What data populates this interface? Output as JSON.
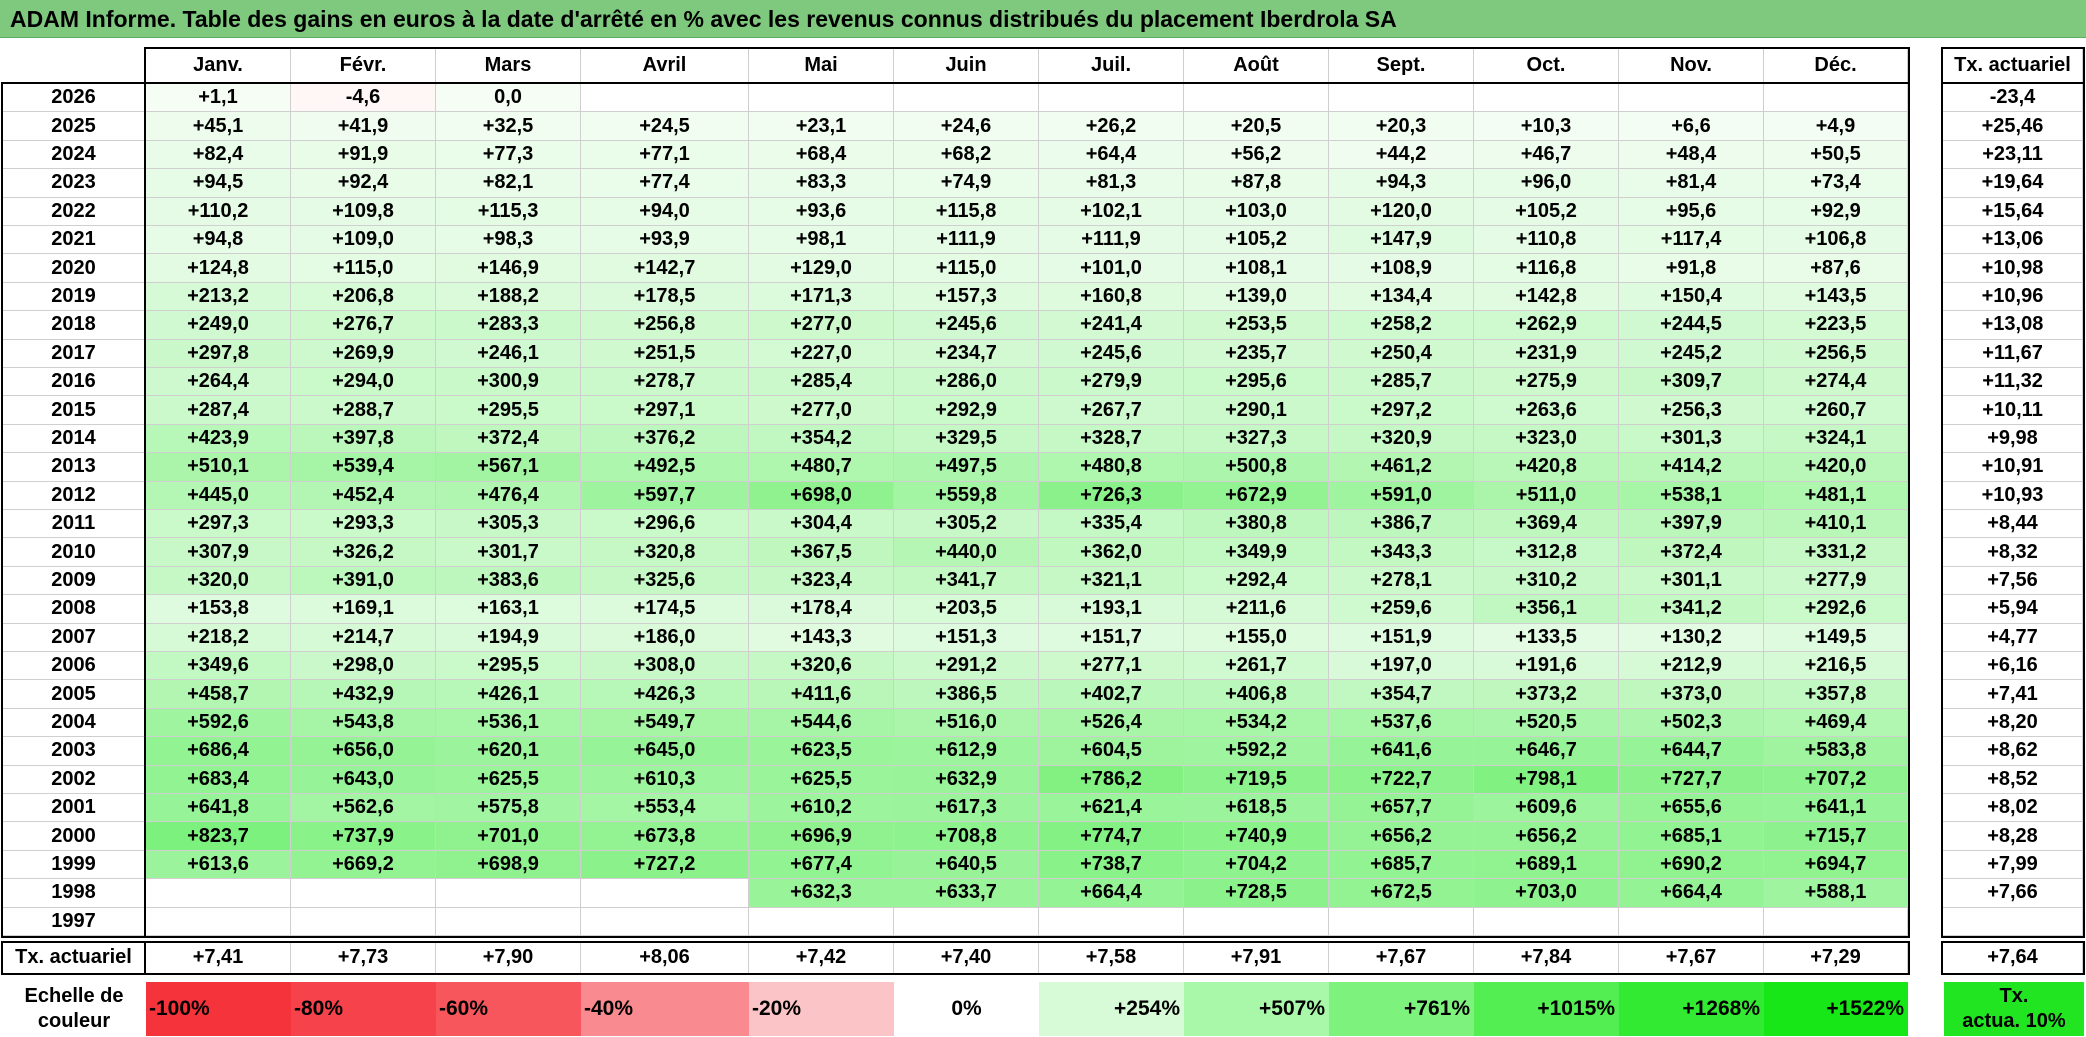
{
  "title": "ADAM Informe. Table des gains en euros à la date d'arrêté en % avec les revenus connus distribués du placement Iberdrola SA",
  "chart_data": {
    "type": "heatmap",
    "months": [
      "Janv.",
      "Févr.",
      "Mars",
      "Avril",
      "Mai",
      "Juin",
      "Juil.",
      "Août",
      "Sept.",
      "Oct.",
      "Nov.",
      "Déc."
    ],
    "rate_header": "Tx. actuariel",
    "rows": [
      {
        "year": "2026",
        "cells": [
          "+1,1",
          "-4,6",
          "0,0",
          "",
          "",
          "",
          "",
          "",
          "",
          "",
          "",
          ""
        ],
        "rate": "-23,4"
      },
      {
        "year": "2025",
        "cells": [
          "+45,1",
          "+41,9",
          "+32,5",
          "+24,5",
          "+23,1",
          "+24,6",
          "+26,2",
          "+20,5",
          "+20,3",
          "+10,3",
          "+6,6",
          "+4,9"
        ],
        "rate": "+25,46"
      },
      {
        "year": "2024",
        "cells": [
          "+82,4",
          "+91,9",
          "+77,3",
          "+77,1",
          "+68,4",
          "+68,2",
          "+64,4",
          "+56,2",
          "+44,2",
          "+46,7",
          "+48,4",
          "+50,5"
        ],
        "rate": "+23,11"
      },
      {
        "year": "2023",
        "cells": [
          "+94,5",
          "+92,4",
          "+82,1",
          "+77,4",
          "+83,3",
          "+74,9",
          "+81,3",
          "+87,8",
          "+94,3",
          "+96,0",
          "+81,4",
          "+73,4"
        ],
        "rate": "+19,64"
      },
      {
        "year": "2022",
        "cells": [
          "+110,2",
          "+109,8",
          "+115,3",
          "+94,0",
          "+93,6",
          "+115,8",
          "+102,1",
          "+103,0",
          "+120,0",
          "+105,2",
          "+95,6",
          "+92,9"
        ],
        "rate": "+15,64"
      },
      {
        "year": "2021",
        "cells": [
          "+94,8",
          "+109,0",
          "+98,3",
          "+93,9",
          "+98,1",
          "+111,9",
          "+111,9",
          "+105,2",
          "+147,9",
          "+110,8",
          "+117,4",
          "+106,8"
        ],
        "rate": "+13,06"
      },
      {
        "year": "2020",
        "cells": [
          "+124,8",
          "+115,0",
          "+146,9",
          "+142,7",
          "+129,0",
          "+115,0",
          "+101,0",
          "+108,1",
          "+108,9",
          "+116,8",
          "+91,8",
          "+87,6"
        ],
        "rate": "+10,98"
      },
      {
        "year": "2019",
        "cells": [
          "+213,2",
          "+206,8",
          "+188,2",
          "+178,5",
          "+171,3",
          "+157,3",
          "+160,8",
          "+139,0",
          "+134,4",
          "+142,8",
          "+150,4",
          "+143,5"
        ],
        "rate": "+10,96"
      },
      {
        "year": "2018",
        "cells": [
          "+249,0",
          "+276,7",
          "+283,3",
          "+256,8",
          "+277,0",
          "+245,6",
          "+241,4",
          "+253,5",
          "+258,2",
          "+262,9",
          "+244,5",
          "+223,5"
        ],
        "rate": "+13,08"
      },
      {
        "year": "2017",
        "cells": [
          "+297,8",
          "+269,9",
          "+246,1",
          "+251,5",
          "+227,0",
          "+234,7",
          "+245,6",
          "+235,7",
          "+250,4",
          "+231,9",
          "+245,2",
          "+256,5"
        ],
        "rate": "+11,67"
      },
      {
        "year": "2016",
        "cells": [
          "+264,4",
          "+294,0",
          "+300,9",
          "+278,7",
          "+285,4",
          "+286,0",
          "+279,9",
          "+295,6",
          "+285,7",
          "+275,9",
          "+309,7",
          "+274,4"
        ],
        "rate": "+11,32"
      },
      {
        "year": "2015",
        "cells": [
          "+287,4",
          "+288,7",
          "+295,5",
          "+297,1",
          "+277,0",
          "+292,9",
          "+267,7",
          "+290,1",
          "+297,2",
          "+263,6",
          "+256,3",
          "+260,7"
        ],
        "rate": "+10,11"
      },
      {
        "year": "2014",
        "cells": [
          "+423,9",
          "+397,8",
          "+372,4",
          "+376,2",
          "+354,2",
          "+329,5",
          "+328,7",
          "+327,3",
          "+320,9",
          "+323,0",
          "+301,3",
          "+324,1"
        ],
        "rate": "+9,98"
      },
      {
        "year": "2013",
        "cells": [
          "+510,1",
          "+539,4",
          "+567,1",
          "+492,5",
          "+480,7",
          "+497,5",
          "+480,8",
          "+500,8",
          "+461,2",
          "+420,8",
          "+414,2",
          "+420,0"
        ],
        "rate": "+10,91"
      },
      {
        "year": "2012",
        "cells": [
          "+445,0",
          "+452,4",
          "+476,4",
          "+597,7",
          "+698,0",
          "+559,8",
          "+726,3",
          "+672,9",
          "+591,0",
          "+511,0",
          "+538,1",
          "+481,1"
        ],
        "rate": "+10,93"
      },
      {
        "year": "2011",
        "cells": [
          "+297,3",
          "+293,3",
          "+305,3",
          "+296,6",
          "+304,4",
          "+305,2",
          "+335,4",
          "+380,8",
          "+386,7",
          "+369,4",
          "+397,9",
          "+410,1"
        ],
        "rate": "+8,44"
      },
      {
        "year": "2010",
        "cells": [
          "+307,9",
          "+326,2",
          "+301,7",
          "+320,8",
          "+367,5",
          "+440,0",
          "+362,0",
          "+349,9",
          "+343,3",
          "+312,8",
          "+372,4",
          "+331,2"
        ],
        "rate": "+8,32"
      },
      {
        "year": "2009",
        "cells": [
          "+320,0",
          "+391,0",
          "+383,6",
          "+325,6",
          "+323,4",
          "+341,7",
          "+321,1",
          "+292,4",
          "+278,1",
          "+310,2",
          "+301,1",
          "+277,9"
        ],
        "rate": "+7,56"
      },
      {
        "year": "2008",
        "cells": [
          "+153,8",
          "+169,1",
          "+163,1",
          "+174,5",
          "+178,4",
          "+203,5",
          "+193,1",
          "+211,6",
          "+259,6",
          "+356,1",
          "+341,2",
          "+292,6"
        ],
        "rate": "+5,94"
      },
      {
        "year": "2007",
        "cells": [
          "+218,2",
          "+214,7",
          "+194,9",
          "+186,0",
          "+143,3",
          "+151,3",
          "+151,7",
          "+155,0",
          "+151,9",
          "+133,5",
          "+130,2",
          "+149,5"
        ],
        "rate": "+4,77"
      },
      {
        "year": "2006",
        "cells": [
          "+349,6",
          "+298,0",
          "+295,5",
          "+308,0",
          "+320,6",
          "+291,2",
          "+277,1",
          "+261,7",
          "+197,0",
          "+191,6",
          "+212,9",
          "+216,5"
        ],
        "rate": "+6,16"
      },
      {
        "year": "2005",
        "cells": [
          "+458,7",
          "+432,9",
          "+426,1",
          "+426,3",
          "+411,6",
          "+386,5",
          "+402,7",
          "+406,8",
          "+354,7",
          "+373,2",
          "+373,0",
          "+357,8"
        ],
        "rate": "+7,41"
      },
      {
        "year": "2004",
        "cells": [
          "+592,6",
          "+543,8",
          "+536,1",
          "+549,7",
          "+544,6",
          "+516,0",
          "+526,4",
          "+534,2",
          "+537,6",
          "+520,5",
          "+502,3",
          "+469,4"
        ],
        "rate": "+8,20"
      },
      {
        "year": "2003",
        "cells": [
          "+686,4",
          "+656,0",
          "+620,1",
          "+645,0",
          "+623,5",
          "+612,9",
          "+604,5",
          "+592,2",
          "+641,6",
          "+646,7",
          "+644,7",
          "+583,8"
        ],
        "rate": "+8,62"
      },
      {
        "year": "2002",
        "cells": [
          "+683,4",
          "+643,0",
          "+625,5",
          "+610,3",
          "+625,5",
          "+632,9",
          "+786,2",
          "+719,5",
          "+722,7",
          "+798,1",
          "+727,7",
          "+707,2"
        ],
        "rate": "+8,52"
      },
      {
        "year": "2001",
        "cells": [
          "+641,8",
          "+562,6",
          "+575,8",
          "+553,4",
          "+610,2",
          "+617,3",
          "+621,4",
          "+618,5",
          "+657,7",
          "+609,6",
          "+655,6",
          "+641,1"
        ],
        "rate": "+8,02"
      },
      {
        "year": "2000",
        "cells": [
          "+823,7",
          "+737,9",
          "+701,0",
          "+673,8",
          "+696,9",
          "+708,8",
          "+774,7",
          "+740,9",
          "+656,2",
          "+656,2",
          "+685,1",
          "+715,7"
        ],
        "rate": "+8,28"
      },
      {
        "year": "1999",
        "cells": [
          "+613,6",
          "+669,2",
          "+698,9",
          "+727,2",
          "+677,4",
          "+640,5",
          "+738,7",
          "+704,2",
          "+685,7",
          "+689,1",
          "+690,2",
          "+694,7"
        ],
        "rate": "+7,99"
      },
      {
        "year": "1998",
        "cells": [
          "",
          "",
          "",
          "",
          "+632,3",
          "+633,7",
          "+664,4",
          "+728,5",
          "+672,5",
          "+703,0",
          "+664,4",
          "+588,1"
        ],
        "rate": "+7,66"
      },
      {
        "year": "1997",
        "cells": [
          "",
          "",
          "",
          "",
          "",
          "",
          "",
          "",
          "",
          "",
          "",
          ""
        ],
        "rate": ""
      }
    ],
    "footer": {
      "label": "Tx. actuariel",
      "cells": [
        "+7,41",
        "+7,73",
        "+7,90",
        "+8,06",
        "+7,42",
        "+7,40",
        "+7,58",
        "+7,91",
        "+7,67",
        "+7,84",
        "+7,67",
        "+7,29"
      ],
      "rate": "+7,64"
    },
    "scale": {
      "label_line1": "Echelle de",
      "label_line2": "couleur",
      "steps": [
        {
          "label": "-100%",
          "color": "#f5333b"
        },
        {
          "label": "-80%",
          "color": "#f6424a"
        },
        {
          "label": "-60%",
          "color": "#f7565d"
        },
        {
          "label": "-40%",
          "color": "#f98a8f"
        },
        {
          "label": "-20%",
          "color": "#fbc4c6"
        },
        {
          "label": "0%",
          "color": "#ffffff"
        },
        {
          "label": "+254%",
          "color": "#d6fbd6"
        },
        {
          "label": "+507%",
          "color": "#a9f7a9"
        },
        {
          "label": "+761%",
          "color": "#7df27d"
        },
        {
          "label": "+1015%",
          "color": "#52ee52"
        },
        {
          "label": "+1268%",
          "color": "#33ea33"
        },
        {
          "label": "+1522%",
          "color": "#17e617"
        }
      ],
      "rate_line1": "Tx.",
      "rate_line2": "actua. 10%",
      "rate_color": "#22e522"
    }
  }
}
